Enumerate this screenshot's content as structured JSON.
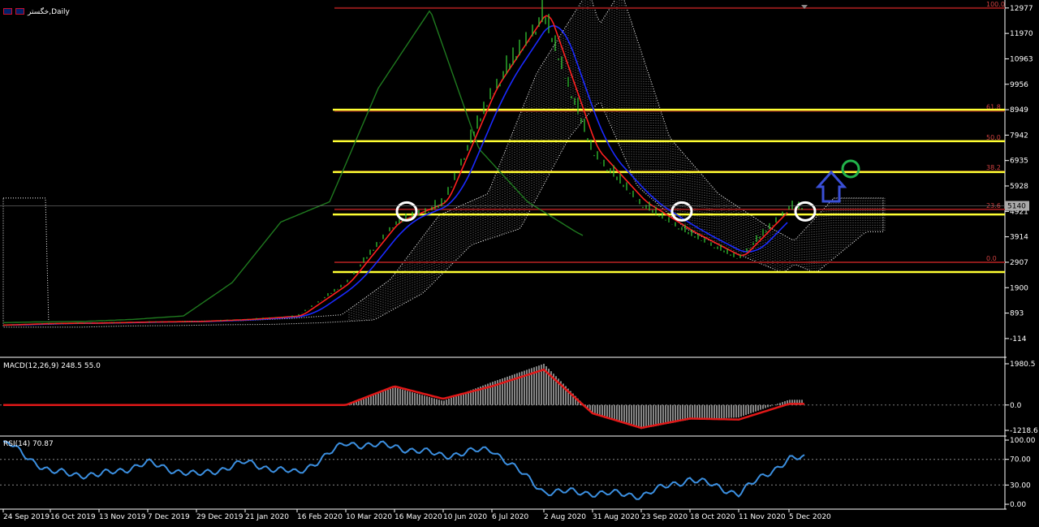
{
  "window": {
    "title": "خگستر,Daily",
    "flag_icon": "uk-flag-icon"
  },
  "chart_data": [
    {
      "type": "candlestick",
      "pane": "price",
      "title": "خگستر,Daily",
      "ylim": [
        -600,
        13100
      ],
      "y_ticks": [
        "12977",
        "11970",
        "10963",
        "9956",
        "8949",
        "7942",
        "6935",
        "5928",
        "4921",
        "3914",
        "2907",
        "1900",
        "893",
        "-114"
      ],
      "current_price_label": "5140",
      "current_price": 5140,
      "grid": false,
      "x_labels": [
        "24 Sep 2019",
        "16 Oct 2019",
        "13 Nov 2019",
        "7 Dec 2019",
        "29 Dec 2019",
        "21 Jan 2020",
        "16 Feb 2020",
        "10 Mar 2020",
        "16 May 2020",
        "10 Jun 2020",
        "6 Jul 2020",
        "2 Aug 2020",
        "31 Aug 2020",
        "23 Sep 2020",
        "18 Oct 2020",
        "11 Nov 2020",
        "5 Dec 2020"
      ],
      "close_series": [
        {
          "x": "24 Sep 2019",
          "y": 420
        },
        {
          "x": "16 Oct 2019",
          "y": 480
        },
        {
          "x": "13 Nov 2019",
          "y": 500
        },
        {
          "x": "7 Dec 2019",
          "y": 540
        },
        {
          "x": "29 Dec 2019",
          "y": 560
        },
        {
          "x": "21 Jan 2020",
          "y": 640
        },
        {
          "x": "16 Feb 2020",
          "y": 780
        },
        {
          "x": "10 Mar 2020",
          "y": 2100
        },
        {
          "x": "16 May 2020",
          "y": 4500
        },
        {
          "x": "10 Jun 2020",
          "y": 5300
        },
        {
          "x": "6 Jul 2020",
          "y": 9800
        },
        {
          "x": "2 Aug 2020",
          "y": 12900
        },
        {
          "x": "31 Aug 2020",
          "y": 7400
        },
        {
          "x": "23 Sep 2020",
          "y": 5300
        },
        {
          "x": "18 Oct 2020",
          "y": 4100
        },
        {
          "x": "11 Nov 2020",
          "y": 3100
        },
        {
          "x": "5 Dec 2020",
          "y": 5140
        }
      ],
      "fib_levels": [
        {
          "label": "100.0",
          "value": 12977,
          "color": "#8b1a1a"
        },
        {
          "label": "61.8",
          "value": 8900,
          "color": "#8b1a1a"
        },
        {
          "label": "50.0",
          "value": 7700,
          "color": "#8b1a1a"
        },
        {
          "label": "38.2",
          "value": 6500,
          "color": "#8b1a1a"
        },
        {
          "label": "23.6",
          "value": 5000,
          "color": "#8b1a1a"
        },
        {
          "label": "0.0",
          "value": 2907,
          "color": "#8b1a1a"
        }
      ],
      "support_resistance_lines": [
        8949,
        7700,
        6480,
        4800,
        2520
      ],
      "line_colors": {
        "tenkan": "#ff2020",
        "kijun": "#1a2aff",
        "chikou": "#1f7a1f",
        "cloud": "#ffffff",
        "levels": "#ffff33",
        "fib": "#8b1a1a"
      },
      "annotations": [
        "white circle at 16 May 2020",
        "white circle at 23 Sep 2020",
        "white circle at 5 Dec 2020",
        "blue up arrow",
        "green circle target"
      ]
    },
    {
      "type": "bar",
      "pane": "macd",
      "title": "MACD(12,26,9) 248.5 55.0",
      "ylim": [
        -1218.6,
        1980.5
      ],
      "y_ticks": [
        "1980.5",
        "0.0",
        "-1218.6"
      ],
      "series": [
        {
          "name": "histogram",
          "points": [
            {
              "x": "10 Mar 2020",
              "y": 0
            },
            {
              "x": "16 May 2020",
              "y": 850
            },
            {
              "x": "10 Jun 2020",
              "y": 200
            },
            {
              "x": "6 Jul 2020",
              "y": 1100
            },
            {
              "x": "2 Aug 2020",
              "y": 1980
            },
            {
              "x": "31 Aug 2020",
              "y": -400
            },
            {
              "x": "23 Sep 2020",
              "y": -1150
            },
            {
              "x": "18 Oct 2020",
              "y": -700
            },
            {
              "x": "11 Nov 2020",
              "y": -600
            },
            {
              "x": "5 Dec 2020",
              "y": 250
            }
          ]
        },
        {
          "name": "signal",
          "points": [
            {
              "x": "24 Sep 2019",
              "y": 0
            },
            {
              "x": "10 Mar 2020",
              "y": 0
            },
            {
              "x": "16 May 2020",
              "y": 900
            },
            {
              "x": "10 Jun 2020",
              "y": 300
            },
            {
              "x": "6 Jul 2020",
              "y": 900
            },
            {
              "x": "2 Aug 2020",
              "y": 1700
            },
            {
              "x": "31 Aug 2020",
              "y": -400
            },
            {
              "x": "23 Sep 2020",
              "y": -1100
            },
            {
              "x": "18 Oct 2020",
              "y": -650
            },
            {
              "x": "11 Nov 2020",
              "y": -700
            },
            {
              "x": "5 Dec 2020",
              "y": 55
            }
          ]
        }
      ]
    },
    {
      "type": "line",
      "pane": "rsi",
      "title": "RSI(14) 70.87",
      "ylim": [
        0,
        100
      ],
      "y_ticks": [
        "100.00",
        "70.00",
        "30.00",
        "0.00"
      ],
      "levels": [
        70,
        30
      ],
      "series": [
        {
          "name": "RSI",
          "points": [
            {
              "x": "24 Sep 2019",
              "y": 100
            },
            {
              "x": "16 Oct 2019",
              "y": 50
            },
            {
              "x": "13 Nov 2019",
              "y": 45
            },
            {
              "x": "7 Dec 2019",
              "y": 64
            },
            {
              "x": "29 Dec 2019",
              "y": 45
            },
            {
              "x": "21 Jan 2020",
              "y": 65
            },
            {
              "x": "16 Feb 2020",
              "y": 48
            },
            {
              "x": "10 Mar 2020",
              "y": 95
            },
            {
              "x": "16 May 2020",
              "y": 90
            },
            {
              "x": "10 Jun 2020",
              "y": 76
            },
            {
              "x": "6 Jul 2020",
              "y": 86
            },
            {
              "x": "2 Aug 2020",
              "y": 20
            },
            {
              "x": "31 Aug 2020",
              "y": 18
            },
            {
              "x": "23 Sep 2020",
              "y": 14
            },
            {
              "x": "18 Oct 2020",
              "y": 40
            },
            {
              "x": "11 Nov 2020",
              "y": 17
            },
            {
              "x": "5 Dec 2020",
              "y": 70.87
            }
          ]
        }
      ]
    }
  ]
}
